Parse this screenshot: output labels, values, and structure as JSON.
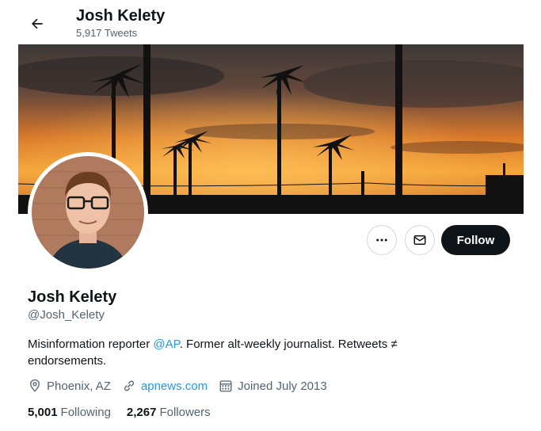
{
  "header": {
    "back_icon": "arrow-left-icon",
    "title": "Josh Kelety",
    "tweet_count": "5,917 Tweets"
  },
  "profile": {
    "name": "Josh Kelety",
    "handle": "@Josh_Kelety",
    "bio_before": "Misinformation reporter ",
    "bio_mention": "@AP",
    "bio_after": ". Former alt-weekly journalist. Retweets ≠ endorsements.",
    "location": "Phoenix, AZ",
    "website": "apnews.com",
    "joined": "Joined July 2013",
    "following_count": "5,001",
    "following_label": "Following",
    "followers_count": "2,267",
    "followers_label": "Followers"
  },
  "actions": {
    "more_icon": "more-dots-icon",
    "message_icon": "mail-icon",
    "follow_label": "Follow"
  },
  "colors": {
    "accent": "#1d9bf0",
    "text": "#0f1419",
    "secondary": "#536471",
    "follow_bg": "#0f1419"
  }
}
